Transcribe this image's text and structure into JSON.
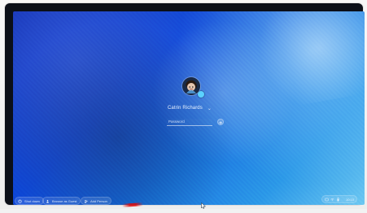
{
  "login": {
    "user_name": "Catrin Richards",
    "password_placeholder": "Password"
  },
  "shelf": {
    "shut_down_label": "Shut down",
    "browse_as_guest_label": "Browse as Guest",
    "add_person_label": "Add Person"
  },
  "status": {
    "time_label": "10:10"
  },
  "icons": {
    "dropdown": "chevron-down-icon",
    "submit": "arrow-right-icon",
    "shut_down": "power-icon",
    "browse_as_guest": "guest-icon",
    "add_person": "add-person-icon",
    "wifi": "wifi-icon",
    "battery": "battery-icon",
    "notifications": "notification-icon",
    "cursor": "mouse-cursor-icon"
  },
  "colors": {
    "wallpaper_dark": "#0b2bb2",
    "wallpaper_light": "#6cc8f2",
    "ui_text": "#e8f2ff"
  }
}
